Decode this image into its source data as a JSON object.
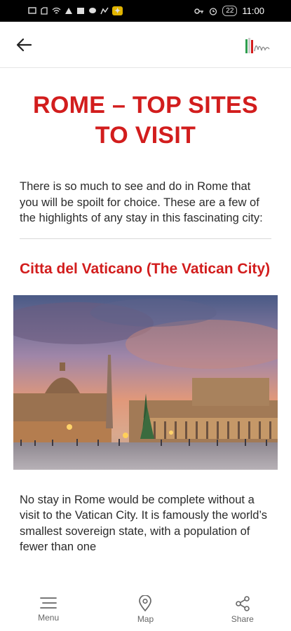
{
  "status_bar": {
    "left_icons": [
      "message-icon",
      "sim-icon",
      "wifi-icon",
      "cast-icon",
      "image-icon",
      "chat-icon",
      "app-icon",
      "accessibility-icon"
    ],
    "right_icons": [
      "key-icon",
      "alarm-icon"
    ],
    "battery": "22",
    "time": "11:00"
  },
  "app_bar": {
    "back_icon": "arrow-left-icon",
    "logo_text": "Italy"
  },
  "article": {
    "title": "ROME – TOP SITES TO VISIT",
    "intro": "There is so much to see and do in Rome that you will be spoilt for choice. These are a few of the highlights of any stay in this fascinating city:",
    "section_title": "Citta del Vaticano (The Vatican City)",
    "body": "No stay in Rome would be complete without a visit to the Vatican City. It is famously the world’s smallest sovereign state, with a population of fewer than one"
  },
  "bottom_nav": {
    "items": [
      {
        "label": "Menu",
        "icon": "menu-icon"
      },
      {
        "label": "Map",
        "icon": "map-pin-icon"
      },
      {
        "label": "Share",
        "icon": "share-icon"
      }
    ]
  },
  "colors": {
    "accent": "#d21d1d",
    "status_bar": "#000000",
    "text": "#2b2b2b"
  }
}
